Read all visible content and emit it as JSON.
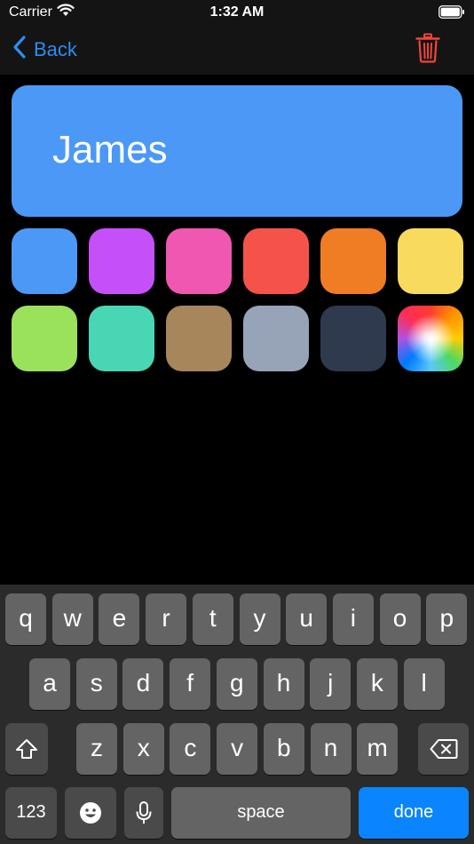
{
  "status_bar": {
    "carrier": "Carrier",
    "time": "1:32 AM",
    "wifi_icon": "wifi-icon",
    "battery_icon": "battery-icon"
  },
  "nav": {
    "back_label": "Back",
    "back_icon": "chevron-left-icon",
    "delete_icon": "trash-icon"
  },
  "name_card": {
    "name": "James",
    "color": "#4b98f7"
  },
  "swatches": [
    {
      "color": "#4b98f7"
    },
    {
      "color": "#c550f9"
    },
    {
      "color": "#ef57b1"
    },
    {
      "color": "#f5534a"
    },
    {
      "color": "#f07c24"
    },
    {
      "color": "#f8db5c"
    },
    {
      "color": "#9ae25b"
    },
    {
      "color": "#49d6b5"
    },
    {
      "color": "#a7865c"
    },
    {
      "color": "#97a4b8"
    },
    {
      "color": "#2f3a4f"
    },
    {
      "color": "spectrum",
      "icon": "color-picker-icon"
    }
  ],
  "keyboard": {
    "row1": [
      "q",
      "w",
      "e",
      "r",
      "t",
      "y",
      "u",
      "i",
      "o",
      "p"
    ],
    "row2": [
      "a",
      "s",
      "d",
      "f",
      "g",
      "h",
      "j",
      "k",
      "l"
    ],
    "row3": [
      "z",
      "x",
      "c",
      "v",
      "b",
      "n",
      "m"
    ],
    "shift_icon": "shift-icon",
    "backspace_icon": "backspace-icon",
    "numbers_label": "123",
    "emoji_icon": "emoji-icon",
    "mic_icon": "microphone-icon",
    "space_label": "space",
    "done_label": "done"
  }
}
